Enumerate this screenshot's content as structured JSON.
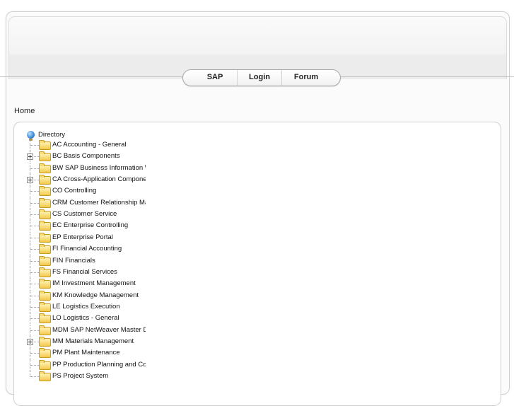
{
  "nav": {
    "tabs": [
      {
        "label": "SAP"
      },
      {
        "label": "Login"
      },
      {
        "label": "Forum"
      }
    ]
  },
  "breadcrumb": "Home",
  "tree": {
    "root": "Directory",
    "items": [
      {
        "label": "AC Accounting - General",
        "expandable": false
      },
      {
        "label": "BC Basis Components",
        "expandable": true
      },
      {
        "label": "BW SAP Business Information Warehouse",
        "expandable": false
      },
      {
        "label": "CA Cross-Application Components",
        "expandable": true
      },
      {
        "label": "CO Controlling",
        "expandable": false
      },
      {
        "label": "CRM Customer Relationship Management",
        "expandable": false
      },
      {
        "label": "CS Customer Service",
        "expandable": false
      },
      {
        "label": "EC Enterprise Controlling",
        "expandable": false
      },
      {
        "label": "EP Enterprise Portal",
        "expandable": false
      },
      {
        "label": "FI Financial Accounting",
        "expandable": false
      },
      {
        "label": "FIN Financials",
        "expandable": false
      },
      {
        "label": "FS Financial Services",
        "expandable": false
      },
      {
        "label": "IM Investment Management",
        "expandable": false
      },
      {
        "label": "KM Knowledge Management",
        "expandable": false
      },
      {
        "label": "LE Logistics Execution",
        "expandable": false
      },
      {
        "label": "LO Logistics - General",
        "expandable": false
      },
      {
        "label": "MDM SAP NetWeaver Master Data Management",
        "expandable": false
      },
      {
        "label": "MM Materials Management",
        "expandable": true
      },
      {
        "label": "PM Plant Maintenance",
        "expandable": false
      },
      {
        "label": "PP Production Planning and Control",
        "expandable": false
      },
      {
        "label": "PS Project System",
        "expandable": false
      }
    ]
  }
}
